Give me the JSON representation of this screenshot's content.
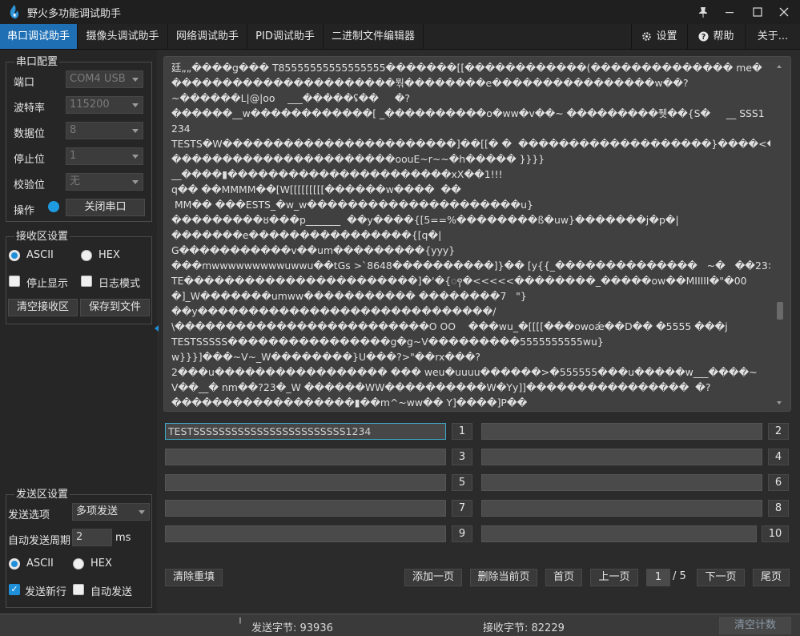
{
  "window": {
    "title": "野火多功能调试助手",
    "pin_icon": "pin-icon",
    "minimize_icon": "minimize-icon",
    "maximize_icon": "maximize-icon",
    "close_icon": "close-icon"
  },
  "tabs": [
    "串口调试助手",
    "摄像头调试助手",
    "网络调试助手",
    "PID调试助手",
    "二进制文件编辑器"
  ],
  "active_tab": "串口调试助手",
  "right_tabs": {
    "settings": "设置",
    "help": "帮助",
    "about": "关于..."
  },
  "serial_config": {
    "title": "串口配置",
    "port_label": "端口",
    "port_value": "COM4 USB",
    "baud_label": "波特率",
    "baud_value": "115200",
    "data_label": "数据位",
    "data_value": "8",
    "stop_label": "停止位",
    "stop_value": "1",
    "parity_label": "校验位",
    "parity_value": "无",
    "operate_label": "操作",
    "close_port_btn": "关闭串口"
  },
  "recv_settings": {
    "title": "接收区设置",
    "ascii": "ASCII",
    "hex": "HEX",
    "stop_display": "停止显示",
    "log_mode": "日志模式",
    "clear_btn": "清空接收区",
    "save_btn": "保存到文件"
  },
  "send_settings": {
    "title": "发送区设置",
    "option_label": "发送选项",
    "option_value": "多项发送",
    "period_label": "自动发送周期",
    "period_value": "2",
    "period_unit": "ms",
    "ascii": "ASCII",
    "hex": "HEX",
    "newline": "发送新行",
    "auto_send": "自动发送"
  },
  "recv_lines": [
    "廷„„����g��� T85555555555555555�������[[������������(�������������� me�",
    "����������������������뭒��������e����������������w��?",
    "~�꫏�����L|@|oo    ___�����ʢ��     �?",
    "������__w������������[ _����������o�ww�v��~ ���������퓃��{S�     __ SSS1",
    "234",
    "TESTS�W�����������������������]��[[� �  �������������������}����<�?",
    "����������������������oouE~r~~�h����� }}}}",
    "__����▮����������������������xX��1!!!",
    "q�� ��MMMM��[W[[[[[[[[[������w����  ��",
    " MM�� ���ESTS_�w_w���������������������u}",
    "���������ȣ���p_______  ��y����{[5==%��������ß�uw}�������j�p�|",
    "�������e����������������{[q�|",
    "G�����������v��um���������{yyy}",
    "���mwwwwwwwwwuwwu��tGs >`8648����������]}�� [y{{_��������������   ~�   ��23>",
    "TE�����������������������]�'�{ꩍ�<<<<<��������_�����ow��MIIIII�\"�00",
    "�]_W�������umww����������� ��������7   \"}",
    "��y�����������������������������/",
    "\\�������������������������O OO    ���wu_�[[[[���owoǽ��D�� �5555 ���j",
    "TESTSSSSS����������������g�g~V���������5555555555wu}",
    "w}}}]���~V~_W��������}U���?>\"��rx���?",
    "2���u����������������� ��� weu�uuuu������>�555555���u�����w___����~",
    "V��__� nm��?23�_W ������WW����������W�Yy]]����������������  �?",
    "������������������▮��m^~ww�� Y]����]P��"
  ],
  "send_items": [
    {
      "value": "TESTSSSSSSSSSSSSSSSSSSSSSSSS1234",
      "num": "1"
    },
    {
      "value": "",
      "num": "2"
    },
    {
      "value": "",
      "num": "3"
    },
    {
      "value": "",
      "num": "4"
    },
    {
      "value": "",
      "num": "5"
    },
    {
      "value": "",
      "num": "6"
    },
    {
      "value": "",
      "num": "7"
    },
    {
      "value": "",
      "num": "8"
    },
    {
      "value": "",
      "num": "9"
    },
    {
      "value": "",
      "num": "10"
    }
  ],
  "bottom_buttons": {
    "clear_refill": "清除重填",
    "add_page": "添加一页",
    "delete_page": "删除当前页",
    "first_page": "首页",
    "prev_page": "上一页",
    "page_current": "1",
    "page_total": "/ 5",
    "next_page": "下一页",
    "last_page": "尾页"
  },
  "status": {
    "sent_bytes": "发送字节: 93936",
    "recv_bytes": "接收字节: 82229",
    "clear_count": "清空计数"
  },
  "colors": {
    "accent": "#1e8fd8",
    "tab_active": "#1f6fb5"
  }
}
